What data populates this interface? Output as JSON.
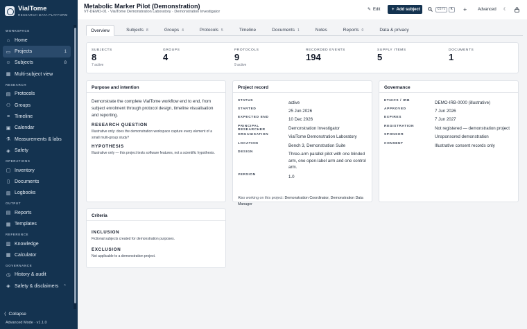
{
  "brand": {
    "name": "VialTome",
    "tagline": "RESEARCH DATA PLATFORM"
  },
  "sidebar": {
    "sections": [
      {
        "label": "WORKSPACE",
        "items": [
          {
            "label": "Home",
            "icon": "home-icon",
            "glyph": "⌂"
          },
          {
            "label": "Projects",
            "icon": "folder-icon",
            "glyph": "▭",
            "count": "1",
            "active": true
          },
          {
            "label": "Subjects",
            "icon": "person-icon",
            "glyph": "☺",
            "count": "8"
          },
          {
            "label": "Multi-subject view",
            "icon": "grid-icon",
            "glyph": "▦"
          }
        ]
      },
      {
        "label": "RESEARCH",
        "items": [
          {
            "label": "Protocols",
            "icon": "document-icon",
            "glyph": "▤"
          },
          {
            "label": "Groups",
            "icon": "group-icon",
            "glyph": "⚇"
          },
          {
            "label": "Timeline",
            "icon": "timeline-icon",
            "glyph": "≡"
          },
          {
            "label": "Calendar",
            "icon": "calendar-icon",
            "glyph": "▣"
          },
          {
            "label": "Measurements & labs",
            "icon": "flask-icon",
            "glyph": "⚗"
          },
          {
            "label": "Safety",
            "icon": "shield-icon",
            "glyph": "◈"
          }
        ]
      },
      {
        "label": "OPERATIONS",
        "items": [
          {
            "label": "Inventory",
            "icon": "box-icon",
            "glyph": "▢"
          },
          {
            "label": "Documents",
            "icon": "file-icon",
            "glyph": "▯"
          },
          {
            "label": "Logbooks",
            "icon": "book-icon",
            "glyph": "▥"
          }
        ]
      },
      {
        "label": "OUTPUT",
        "items": [
          {
            "label": "Reports",
            "icon": "report-icon",
            "glyph": "▤"
          },
          {
            "label": "Templates",
            "icon": "template-icon",
            "glyph": "▦"
          }
        ]
      },
      {
        "label": "REFERENCE",
        "items": [
          {
            "label": "Knowledge",
            "icon": "book-open-icon",
            "glyph": "▥"
          },
          {
            "label": "Calculator",
            "icon": "calculator-icon",
            "glyph": "▦"
          }
        ]
      },
      {
        "label": "GOVERNANCE",
        "items": [
          {
            "label": "History & audit",
            "icon": "history-icon",
            "glyph": "◷"
          },
          {
            "label": "Safety & disclaimers",
            "icon": "shield-icon",
            "glyph": "◈",
            "chevron": "⌃"
          }
        ]
      }
    ],
    "collapse_label": "Collapse",
    "mode_label": "Advanced Mode · v1.1.0"
  },
  "header": {
    "title": "Metabolic Marker Pilot (Demonstration)",
    "subtitle": "VT-DEMO-01 · VialTome Demonstration Laboratory · Demonstration Investigator",
    "edit_label": "Edit",
    "add_subject_label": "Add subject",
    "kbd_ctrl": "Ctrl",
    "kbd_k": "K",
    "advanced_label": "Advanced"
  },
  "tabs": [
    {
      "label": "Overview",
      "active": true
    },
    {
      "label": "Subjects",
      "badge": "8"
    },
    {
      "label": "Groups",
      "badge": "4"
    },
    {
      "label": "Protocols",
      "badge": "5"
    },
    {
      "label": "Timeline"
    },
    {
      "label": "Documents",
      "badge": "1"
    },
    {
      "label": "Notes"
    },
    {
      "label": "Reports",
      "badge": "0"
    },
    {
      "label": "Data & privacy"
    }
  ],
  "stats": [
    {
      "label": "SUBJECTS",
      "value": "8",
      "sub": "7 active"
    },
    {
      "label": "GROUPS",
      "value": "4",
      "sub": ""
    },
    {
      "label": "PROTOCOLS",
      "value": "9",
      "sub": "9 active"
    },
    {
      "label": "RECORDED EVENTS",
      "value": "194",
      "sub": ""
    },
    {
      "label": "SUPPLY ITEMS",
      "value": "5",
      "sub": ""
    },
    {
      "label": "DOCUMENTS",
      "value": "1",
      "sub": ""
    }
  ],
  "purpose": {
    "title": "Purpose and intention",
    "text": "Demonstrate the complete VialTome workflow end to end, from subject enrolment through protocol design, timeline visualisation and reporting.",
    "rq_heading": "RESEARCH QUESTION",
    "rq_text": "Illustrative only: does the demonstration workspace capture every element of a small multi-group study?",
    "hyp_heading": "HYPOTHESIS",
    "hyp_text": "Illustrative only — this project tests software features, not a scientific hypothesis."
  },
  "project_record": {
    "title": "Project record",
    "rows": [
      {
        "key": "STATUS",
        "value": "active"
      },
      {
        "key": "STARTED",
        "value": "25 Jun 2026"
      },
      {
        "key": "EXPECTED END",
        "value": "10 Dec 2026"
      },
      {
        "key": "PRINCIPAL RESEARCHER",
        "value": "Demonstration Investigator"
      },
      {
        "key": "ORGANISATION",
        "value": "VialTome Demonstration Laboratory"
      },
      {
        "key": "LOCATION",
        "value": "Bench 3, Demonstration Suite"
      },
      {
        "key": "DESIGN",
        "value": "Three-arm parallel pilot with one blinded arm, one open-label arm and one control arm."
      },
      {
        "key": "VERSION",
        "value": "1.0"
      }
    ],
    "also_prefix": "Also working on this project:",
    "also_names": "Demonstration Coordinator, Demonstration Data Manager"
  },
  "governance": {
    "title": "Governance",
    "rows": [
      {
        "key": "ETHICS / IRB",
        "value": "DEMO-IRB-0000 (illustrative)"
      },
      {
        "key": "APPROVED",
        "value": "7 Jun 2026"
      },
      {
        "key": "EXPIRES",
        "value": "7 Jun 2027"
      },
      {
        "key": "REGISTRATION",
        "value": "Not registered — demonstration project"
      },
      {
        "key": "SPONSOR",
        "value": "Unsponsored demonstration"
      },
      {
        "key": "CONSENT",
        "value": "Illustrative consent records only"
      }
    ]
  },
  "criteria": {
    "title": "Criteria",
    "inclusion_heading": "INCLUSION",
    "inclusion_text": "Fictional subjects created for demonstration purposes.",
    "exclusion_heading": "EXCLUSION",
    "exclusion_text": "Not applicable to a demonstration project."
  }
}
